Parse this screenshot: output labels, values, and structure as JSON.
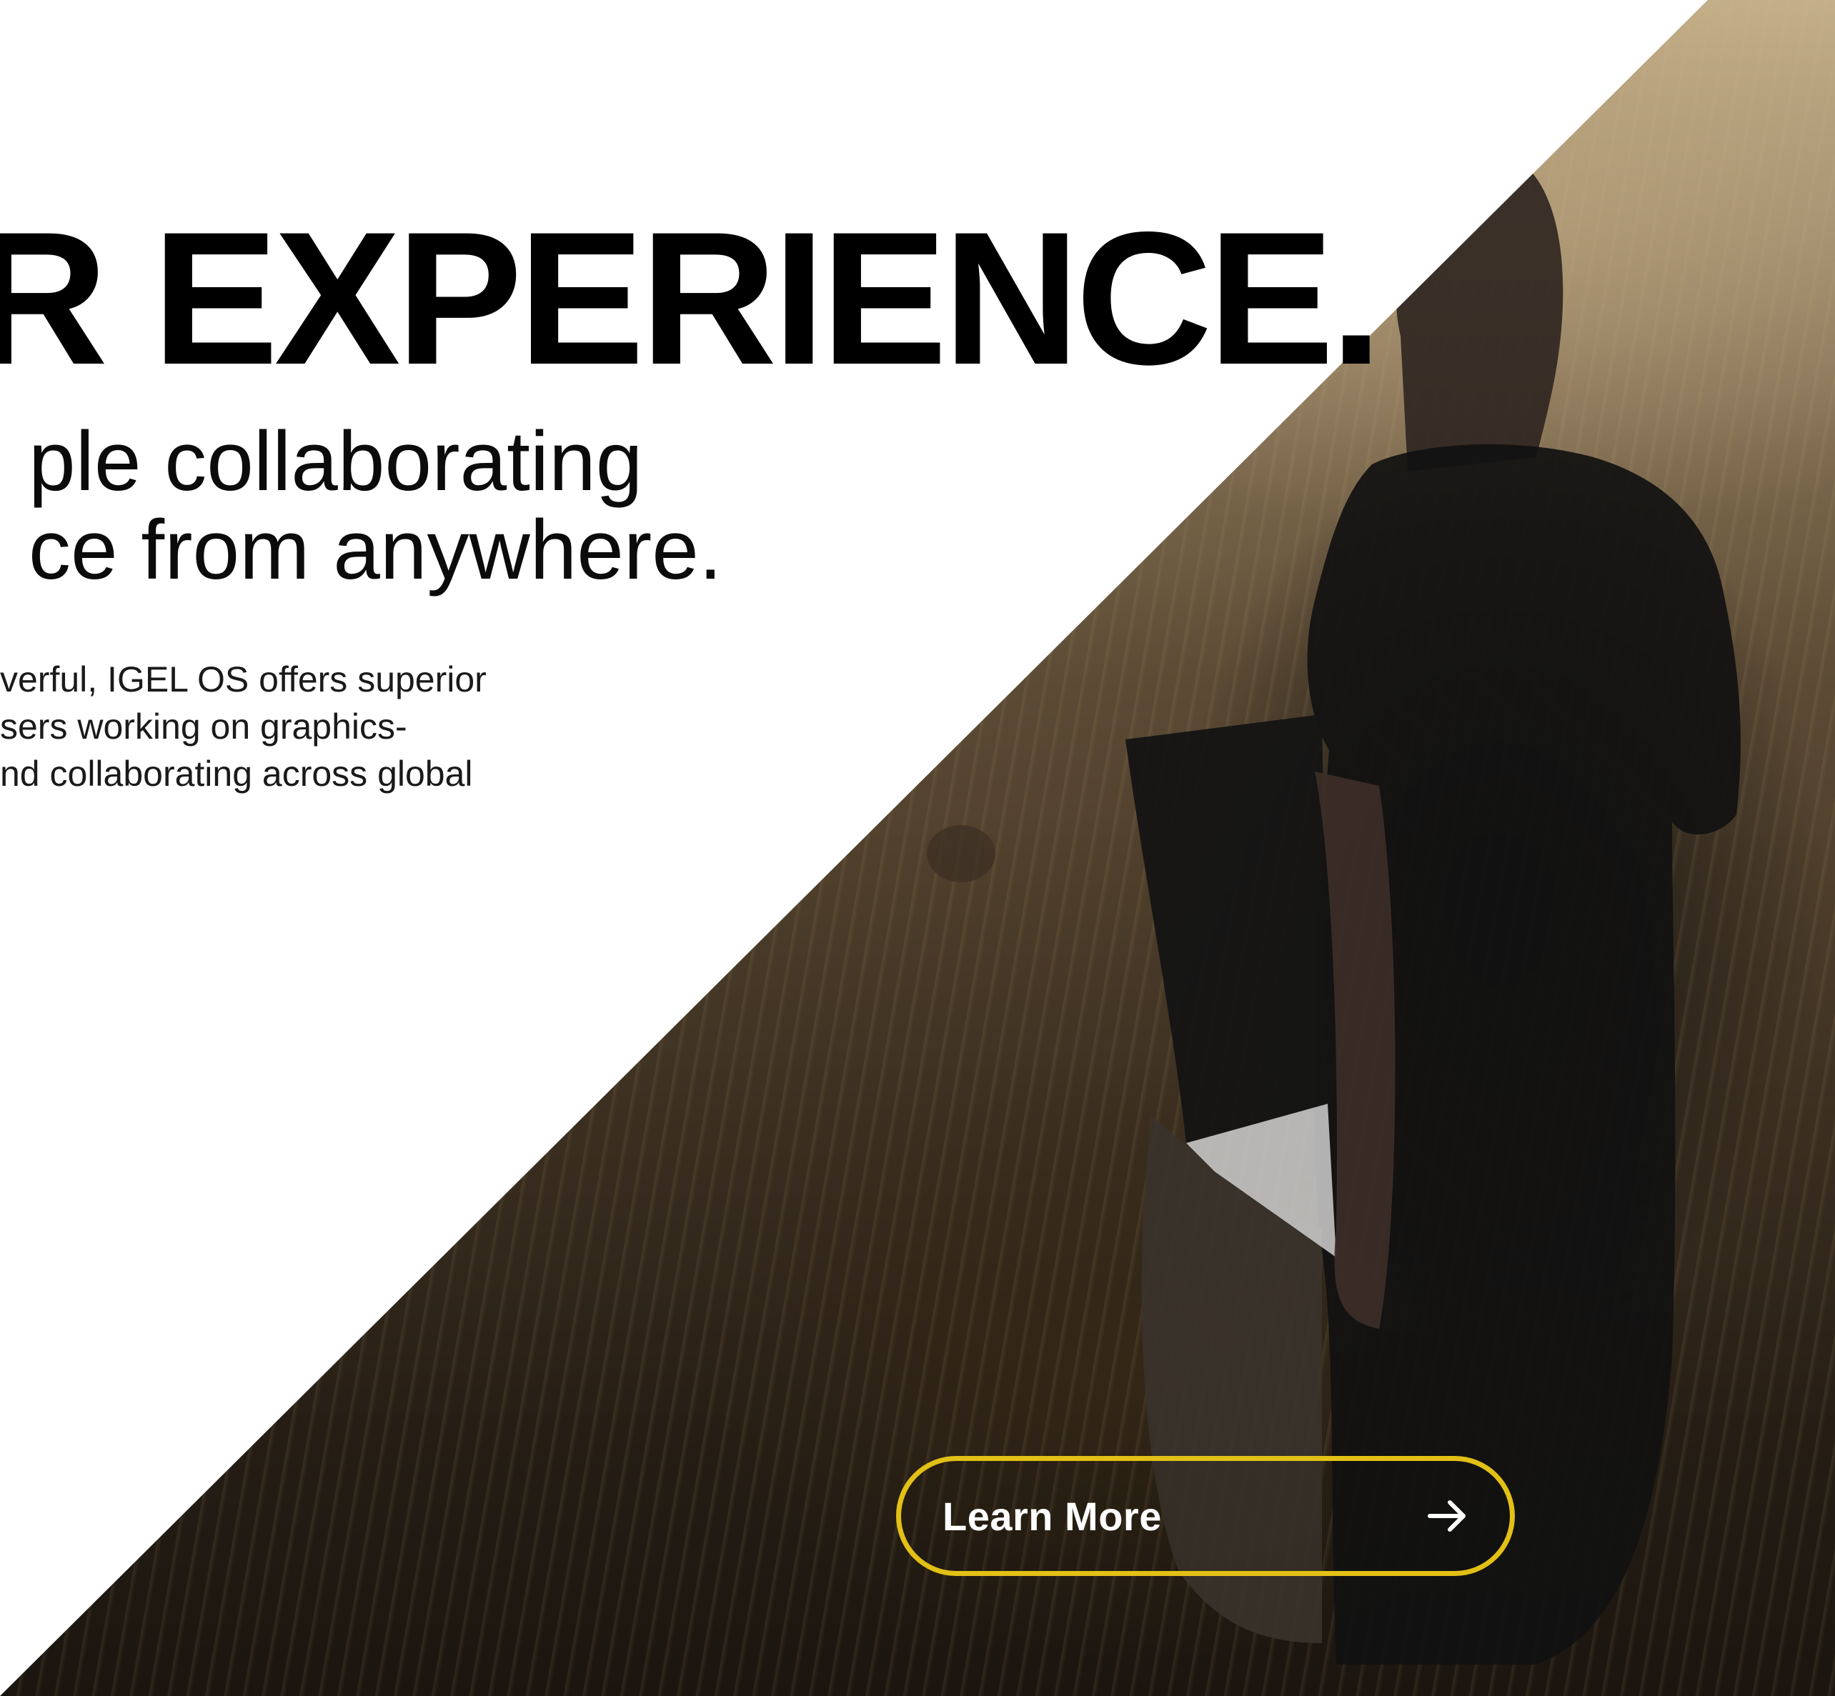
{
  "hero": {
    "headline": "R EXPERIENCE.",
    "subhead_line1": "ple collaborating",
    "subhead_line2": "ce from anywhere.",
    "body_line1": "verful, IGEL OS offers superior",
    "body_line2": "sers working on graphics-",
    "body_line3": "nd collaborating across global"
  },
  "cta": {
    "label": "Learn More",
    "icon": "arrow-right-icon",
    "border_color": "#e2c016"
  },
  "background": {
    "image": "person-with-laptop-in-field-photo"
  }
}
